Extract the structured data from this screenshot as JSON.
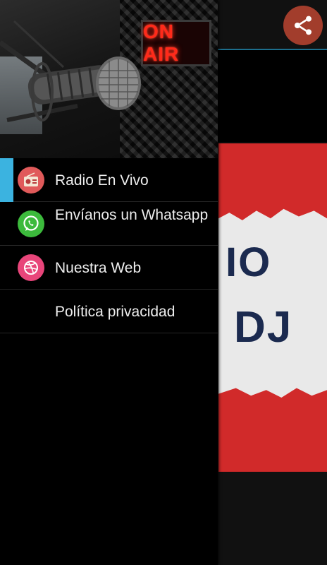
{
  "drawer": {
    "header": {
      "sign_text": "ON AIR"
    },
    "items": [
      {
        "label": "Radio En Vivo",
        "icon": "radio-icon",
        "icon_color": "#e05a5a",
        "active": true
      },
      {
        "label": "Envíanos un Whatsapp",
        "icon": "whatsapp-icon",
        "icon_color": "#3cba3c",
        "active": false
      },
      {
        "label": "Nuestra Web",
        "icon": "dribbble-icon",
        "icon_color": "#e8457a",
        "active": false
      },
      {
        "label": "Política privacidad",
        "icon": "",
        "active": false
      }
    ]
  },
  "background": {
    "logo_text_line1": "IO",
    "logo_text_line2": "DJ",
    "share_icon": "share-icon"
  },
  "colors": {
    "active_indicator": "#3bb3e0",
    "share_button": "#a23d2c",
    "toolbar_underline": "#1d6f8d",
    "logo_red": "#d12a2a"
  }
}
